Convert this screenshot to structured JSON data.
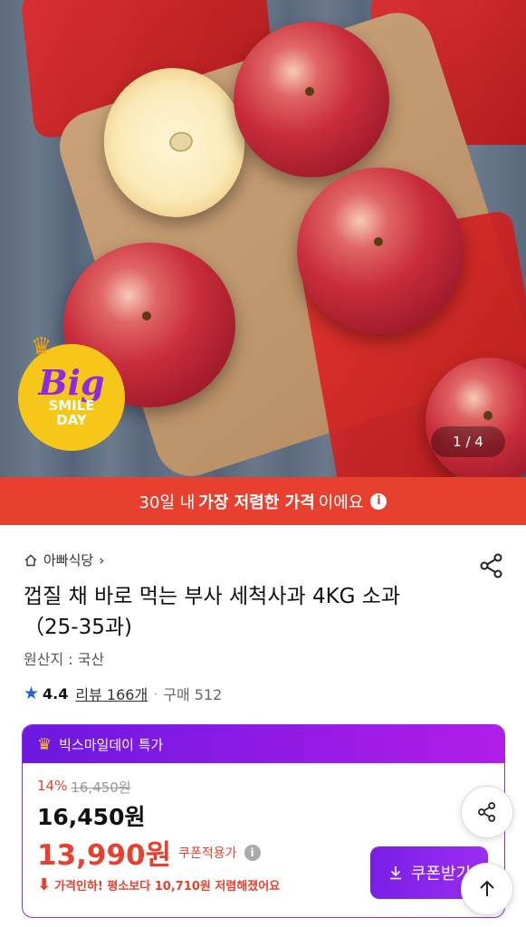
{
  "hero": {
    "badge": {
      "big": "Big",
      "line1": "SMILE",
      "line2": "DAY"
    },
    "counter": "1 / 4"
  },
  "banner": {
    "prefix": "30일 내",
    "emphasis": "가장 저렴한 가격",
    "suffix": "이에요",
    "info_icon": "i"
  },
  "product": {
    "store": "아빠식당",
    "title": "껍질 채 바로 먹는 부사 세척사과 4KG 소과（25-35과)",
    "origin": "원산지 : 국산",
    "rating": "4.4",
    "reviews": "리뷰 166개",
    "purchases": "구매 512"
  },
  "deal": {
    "header": "빅스마일데이 특가",
    "discount_pct": "14%",
    "original_price": "16,450원",
    "price": "16,450원",
    "sale_price": "13,990원",
    "coupon_note": "쿠폰적용가",
    "drop_text": "가격인하! 평소보다 10,710원 저렴해졌어요",
    "coupon_button": "쿠폰받기"
  },
  "icons": {
    "home": "home-icon",
    "share": "share-icon",
    "star": "star-icon",
    "crown": "crown-icon",
    "down_arrow": "download-icon",
    "up_arrow": "arrow-up-icon"
  },
  "colors": {
    "accent_red": "#e8402f",
    "purple": "#8f2ef0",
    "star_blue": "#1e63e0"
  }
}
